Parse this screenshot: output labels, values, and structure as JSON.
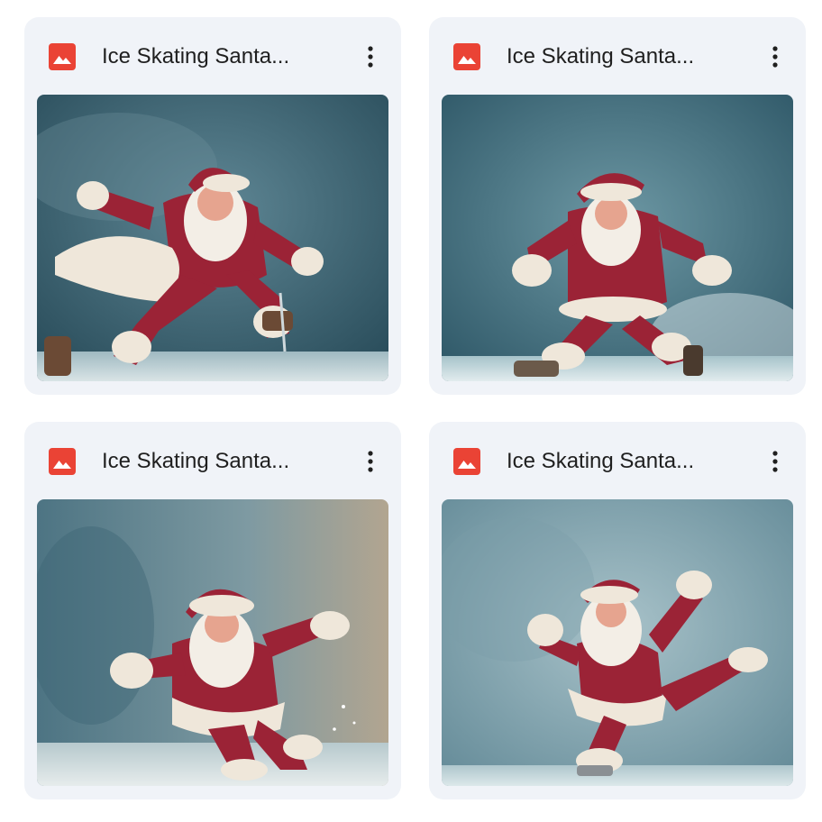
{
  "files": [
    {
      "title": "Ice Skating Santa...",
      "icon": "image-file-icon",
      "menu_icon": "more-vert-icon"
    },
    {
      "title": "Ice Skating Santa...",
      "icon": "image-file-icon",
      "menu_icon": "more-vert-icon"
    },
    {
      "title": "Ice Skating Santa...",
      "icon": "image-file-icon",
      "menu_icon": "more-vert-icon"
    },
    {
      "title": "Ice Skating Santa...",
      "icon": "image-file-icon",
      "menu_icon": "more-vert-icon"
    }
  ],
  "colors": {
    "card_bg": "#f0f3f8",
    "icon_red": "#ea4335",
    "title_text": "#1f1f1f",
    "suit_red": "#9b2336",
    "fur_white": "#efe7da",
    "backdrop": "#3f6a78"
  }
}
